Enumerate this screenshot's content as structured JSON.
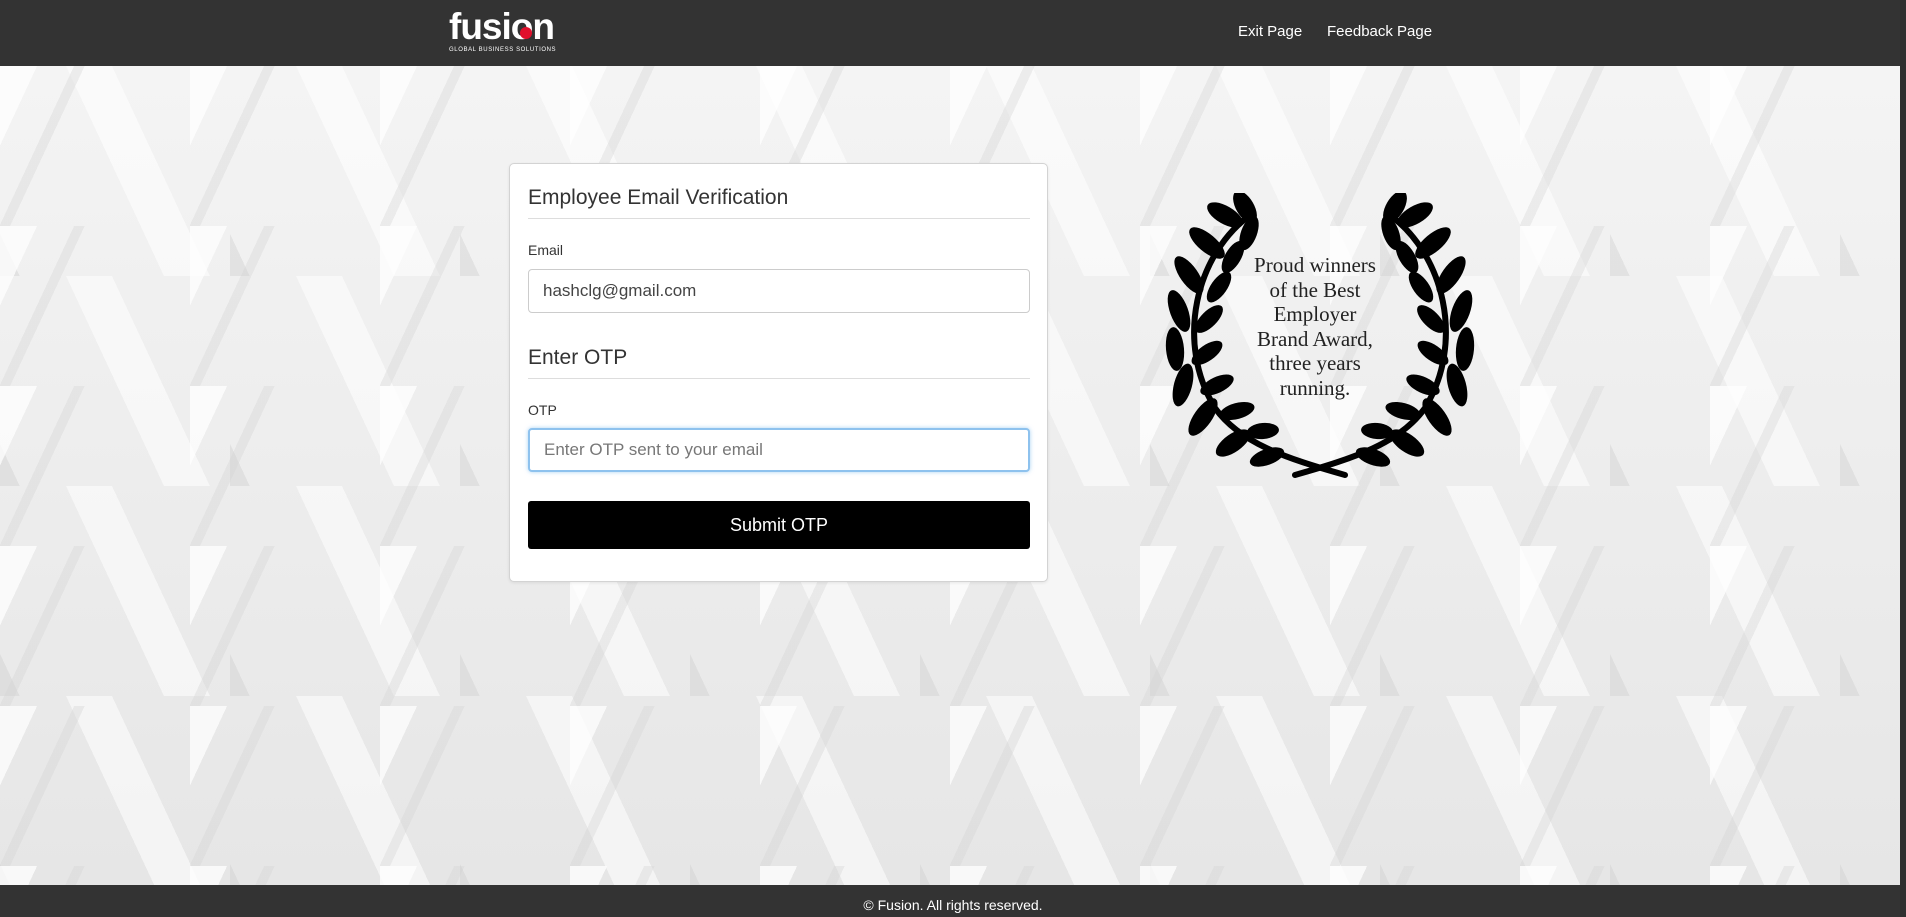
{
  "header": {
    "logo_text": "fusion",
    "logo_tagline": "GLOBAL BUSINESS SOLUTIONS",
    "nav": [
      {
        "label": "Exit Page"
      },
      {
        "label": "Feedback Page"
      }
    ]
  },
  "form": {
    "email_section_title": "Employee Email Verification",
    "email_label": "Email",
    "email_value": "hashclg@gmail.com",
    "otp_section_title": "Enter OTP",
    "otp_label": "OTP",
    "otp_value": "",
    "otp_placeholder": "Enter OTP sent to your email",
    "submit_label": "Submit OTP"
  },
  "award": {
    "text": "Proud winners\nof the Best\nEmployer\nBrand Award,\nthree years\nrunning.",
    "icon": "laurel-wreath-icon"
  },
  "footer": {
    "text": "© Fusion. All rights reserved."
  },
  "colors": {
    "header_bg": "#333333",
    "button_bg": "#000000",
    "brand_accent": "#e0102c",
    "focus_border": "#8ec2ee"
  }
}
